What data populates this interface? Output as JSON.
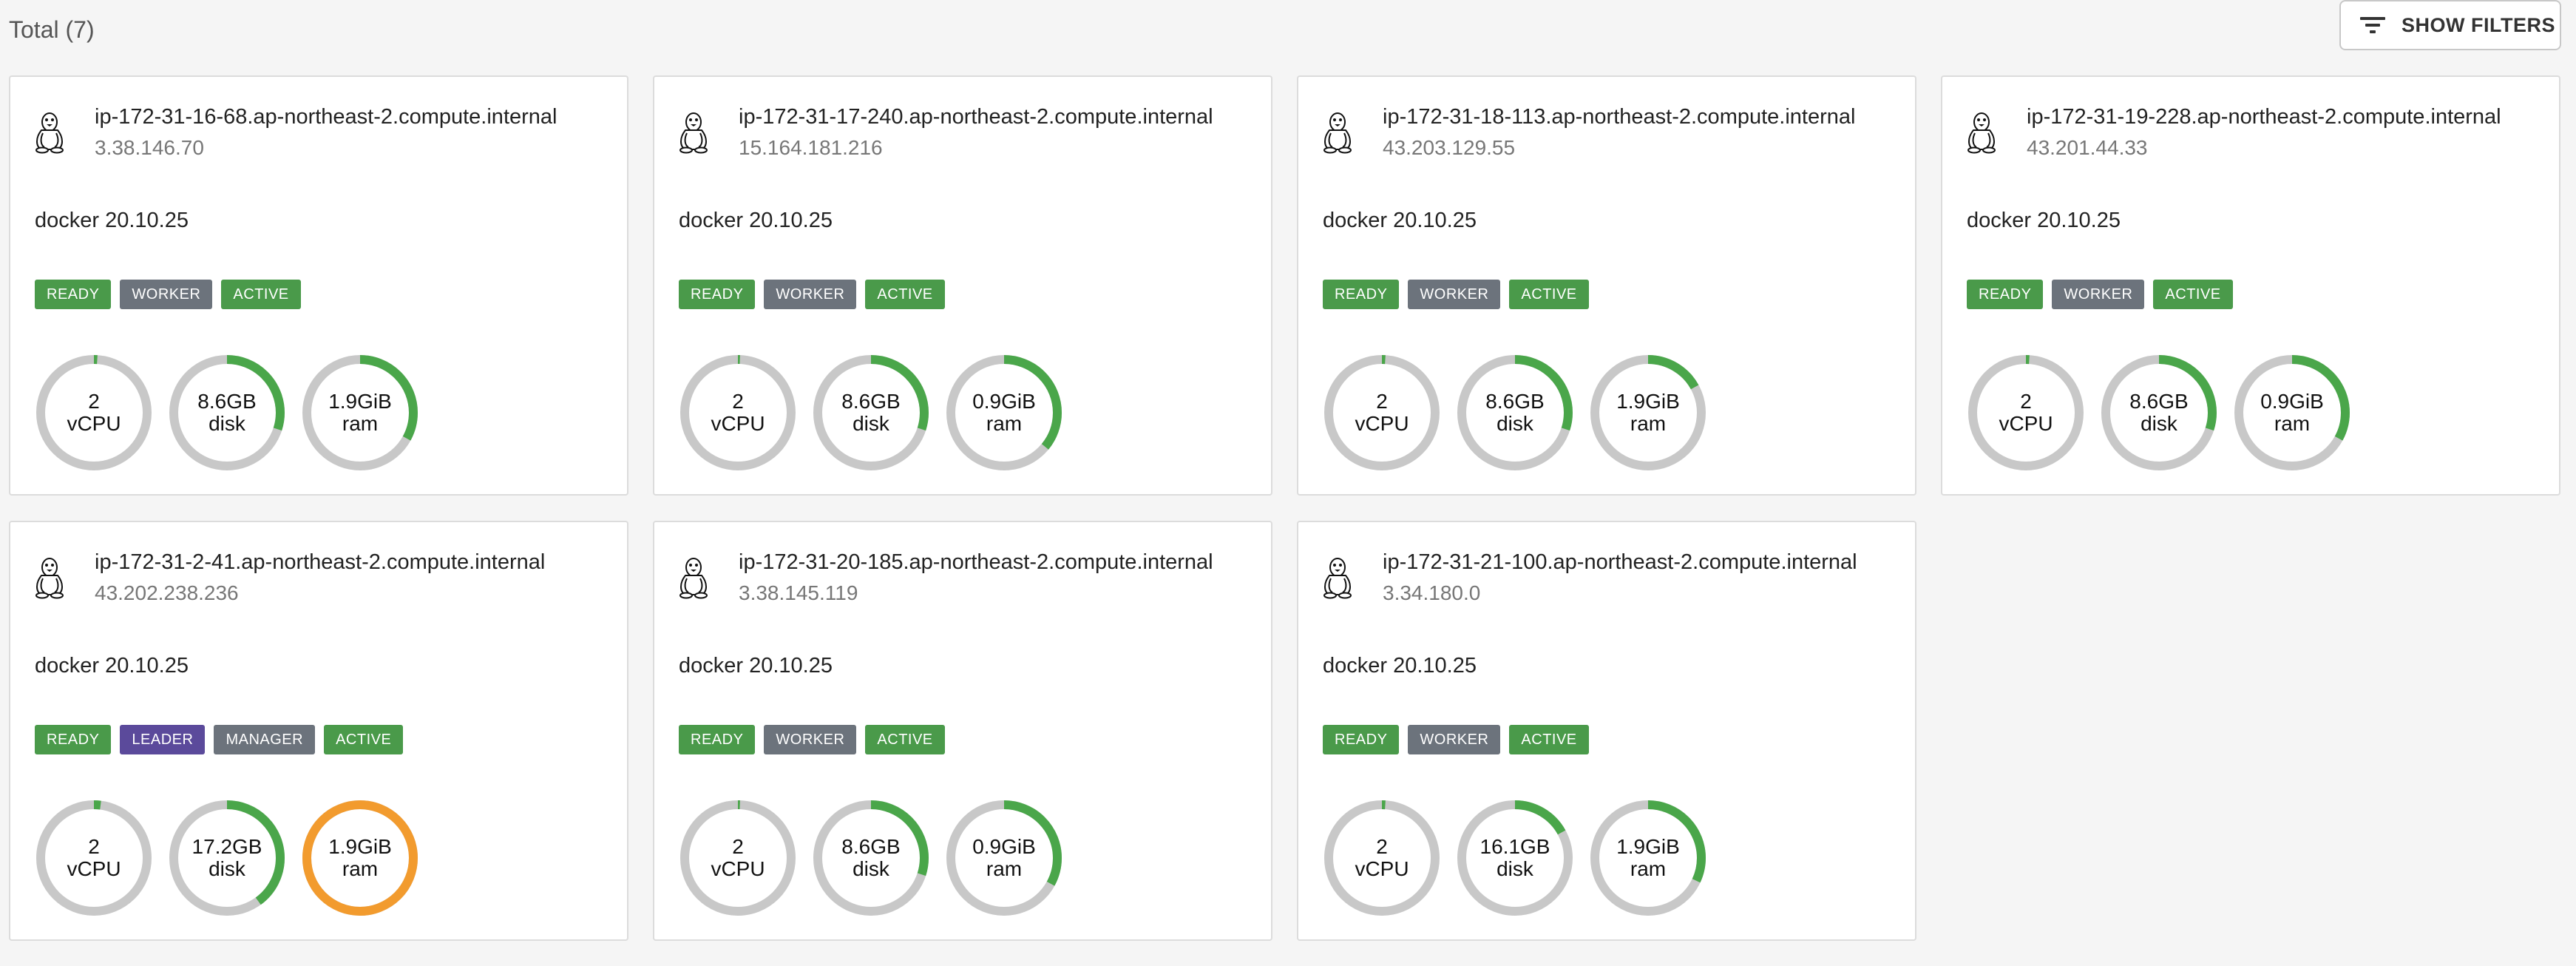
{
  "header": {
    "total_label": "Total (7)",
    "filters_button_label": "SHOW FILTERS",
    "filters_icon": "filter-list-icon"
  },
  "colors": {
    "ready": "#4a9a4a",
    "worker": "#6c737c",
    "active": "#4a9a4a",
    "leader": "#5b4a9b",
    "manager": "#6c737c",
    "gauge_track": "#c8c8c8",
    "gauge_ok": "#4aa64a",
    "gauge_warn": "#f29b2e"
  },
  "nodes": [
    {
      "hostname": "ip-172-31-16-68.ap-northeast-2.compute.internal",
      "ip": "3.38.146.70",
      "engine": "docker 20.10.25",
      "badges": [
        {
          "label": "READY",
          "kind": "ready"
        },
        {
          "label": "WORKER",
          "kind": "worker"
        },
        {
          "label": "ACTIVE",
          "kind": "active"
        }
      ],
      "gauges": [
        {
          "value": "2",
          "unit": "vCPU",
          "fraction": 0.01,
          "status": "ok"
        },
        {
          "value": "8.6GB",
          "unit": "disk",
          "fraction": 0.3,
          "status": "ok"
        },
        {
          "value": "1.9GiB",
          "unit": "ram",
          "fraction": 0.33,
          "status": "ok"
        }
      ]
    },
    {
      "hostname": "ip-172-31-17-240.ap-northeast-2.compute.internal",
      "ip": "15.164.181.216",
      "engine": "docker 20.10.25",
      "badges": [
        {
          "label": "READY",
          "kind": "ready"
        },
        {
          "label": "WORKER",
          "kind": "worker"
        },
        {
          "label": "ACTIVE",
          "kind": "active"
        }
      ],
      "gauges": [
        {
          "value": "2",
          "unit": "vCPU",
          "fraction": 0.0,
          "status": "ok"
        },
        {
          "value": "8.6GB",
          "unit": "disk",
          "fraction": 0.3,
          "status": "ok"
        },
        {
          "value": "0.9GiB",
          "unit": "ram",
          "fraction": 0.36,
          "status": "ok"
        }
      ]
    },
    {
      "hostname": "ip-172-31-18-113.ap-northeast-2.compute.internal",
      "ip": "43.203.129.55",
      "engine": "docker 20.10.25",
      "badges": [
        {
          "label": "READY",
          "kind": "ready"
        },
        {
          "label": "WORKER",
          "kind": "worker"
        },
        {
          "label": "ACTIVE",
          "kind": "active"
        }
      ],
      "gauges": [
        {
          "value": "2",
          "unit": "vCPU",
          "fraction": 0.01,
          "status": "ok"
        },
        {
          "value": "8.6GB",
          "unit": "disk",
          "fraction": 0.3,
          "status": "ok"
        },
        {
          "value": "1.9GiB",
          "unit": "ram",
          "fraction": 0.17,
          "status": "ok"
        }
      ]
    },
    {
      "hostname": "ip-172-31-19-228.ap-northeast-2.compute.internal",
      "ip": "43.201.44.33",
      "engine": "docker 20.10.25",
      "badges": [
        {
          "label": "READY",
          "kind": "ready"
        },
        {
          "label": "WORKER",
          "kind": "worker"
        },
        {
          "label": "ACTIVE",
          "kind": "active"
        }
      ],
      "gauges": [
        {
          "value": "2",
          "unit": "vCPU",
          "fraction": 0.01,
          "status": "ok"
        },
        {
          "value": "8.6GB",
          "unit": "disk",
          "fraction": 0.3,
          "status": "ok"
        },
        {
          "value": "0.9GiB",
          "unit": "ram",
          "fraction": 0.33,
          "status": "ok"
        }
      ]
    },
    {
      "hostname": "ip-172-31-2-41.ap-northeast-2.compute.internal",
      "ip": "43.202.238.236",
      "engine": "docker 20.10.25",
      "badges": [
        {
          "label": "READY",
          "kind": "ready"
        },
        {
          "label": "LEADER",
          "kind": "leader"
        },
        {
          "label": "MANAGER",
          "kind": "manager"
        },
        {
          "label": "ACTIVE",
          "kind": "active"
        }
      ],
      "gauges": [
        {
          "value": "2",
          "unit": "vCPU",
          "fraction": 0.02,
          "status": "ok"
        },
        {
          "value": "17.2GB",
          "unit": "disk",
          "fraction": 0.4,
          "status": "ok"
        },
        {
          "value": "1.9GiB",
          "unit": "ram",
          "fraction": 1.0,
          "status": "warn"
        }
      ]
    },
    {
      "hostname": "ip-172-31-20-185.ap-northeast-2.compute.internal",
      "ip": "3.38.145.119",
      "engine": "docker 20.10.25",
      "badges": [
        {
          "label": "READY",
          "kind": "ready"
        },
        {
          "label": "WORKER",
          "kind": "worker"
        },
        {
          "label": "ACTIVE",
          "kind": "active"
        }
      ],
      "gauges": [
        {
          "value": "2",
          "unit": "vCPU",
          "fraction": 0.0,
          "status": "ok"
        },
        {
          "value": "8.6GB",
          "unit": "disk",
          "fraction": 0.3,
          "status": "ok"
        },
        {
          "value": "0.9GiB",
          "unit": "ram",
          "fraction": 0.33,
          "status": "ok"
        }
      ]
    },
    {
      "hostname": "ip-172-31-21-100.ap-northeast-2.compute.internal",
      "ip": "3.34.180.0",
      "engine": "docker 20.10.25",
      "badges": [
        {
          "label": "READY",
          "kind": "ready"
        },
        {
          "label": "WORKER",
          "kind": "worker"
        },
        {
          "label": "ACTIVE",
          "kind": "active"
        }
      ],
      "gauges": [
        {
          "value": "2",
          "unit": "vCPU",
          "fraction": 0.01,
          "status": "ok"
        },
        {
          "value": "16.1GB",
          "unit": "disk",
          "fraction": 0.17,
          "status": "ok"
        },
        {
          "value": "1.9GiB",
          "unit": "ram",
          "fraction": 0.32,
          "status": "ok"
        }
      ]
    }
  ]
}
